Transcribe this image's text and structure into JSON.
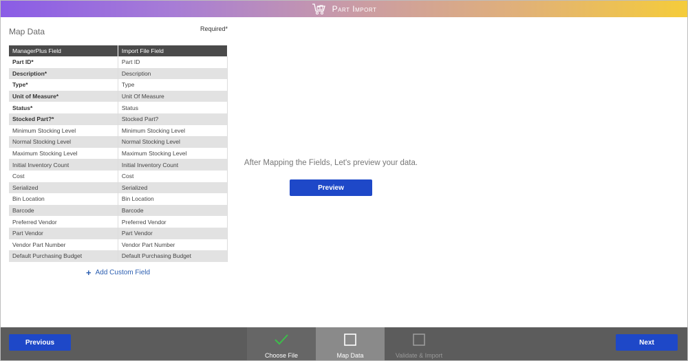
{
  "window": {
    "title": "Part Import",
    "icon": "cart-icon"
  },
  "map_data": {
    "heading": "Map Data",
    "required_note": "Required*",
    "columns": [
      "ManagerPlus Field",
      "Import File Field"
    ],
    "rows": [
      {
        "field": "Part ID*",
        "import": "Part ID",
        "required": true
      },
      {
        "field": "Description*",
        "import": "Description",
        "required": true
      },
      {
        "field": "Type*",
        "import": "Type",
        "required": true
      },
      {
        "field": "Unit of Measure*",
        "import": "Unit Of Measure",
        "required": true
      },
      {
        "field": "Status*",
        "import": "Status",
        "required": true
      },
      {
        "field": "Stocked Part?*",
        "import": "Stocked Part?",
        "required": true
      },
      {
        "field": "Minimum Stocking Level",
        "import": "Minimum Stocking Level",
        "required": false
      },
      {
        "field": "Normal Stocking Level",
        "import": "Normal Stocking Level",
        "required": false
      },
      {
        "field": "Maximum Stocking Level",
        "import": "Maximum Stocking Level",
        "required": false
      },
      {
        "field": "Initial Inventory Count",
        "import": "Initial Inventory Count",
        "required": false
      },
      {
        "field": "Cost",
        "import": "Cost",
        "required": false
      },
      {
        "field": "Serialized",
        "import": "Serialized",
        "required": false
      },
      {
        "field": "Bin Location",
        "import": "Bin Location",
        "required": false
      },
      {
        "field": "Barcode",
        "import": "Barcode",
        "required": false
      },
      {
        "field": "Preferred Vendor",
        "import": "Preferred Vendor",
        "required": false
      },
      {
        "field": "Part Vendor",
        "import": "Part Vendor",
        "required": false
      },
      {
        "field": "Vendor Part Number",
        "import": "Vendor Part Number",
        "required": false
      },
      {
        "field": "Default Purchasing Budget",
        "import": "Default Purchasing Budget",
        "required": false
      }
    ],
    "add_custom_field": "Add Custom Field"
  },
  "preview": {
    "message": "After Mapping the Fields, Let's preview your data.",
    "button": "Preview"
  },
  "footer": {
    "previous": "Previous",
    "next": "Next",
    "steps": [
      {
        "label": "Choose File",
        "icon": "checkmark-icon",
        "state": "complete"
      },
      {
        "label": "Map Data",
        "icon": "empty-square-icon",
        "state": "active"
      },
      {
        "label": "Validate & Import",
        "icon": "empty-square-icon",
        "state": "upcoming"
      }
    ]
  },
  "colors": {
    "accent": "#1e48c8",
    "footer_bg": "#5c5c5c",
    "check": "#3cbf4a",
    "title_gradient": [
      "#8a5ce6",
      "#f5cc3a"
    ]
  }
}
